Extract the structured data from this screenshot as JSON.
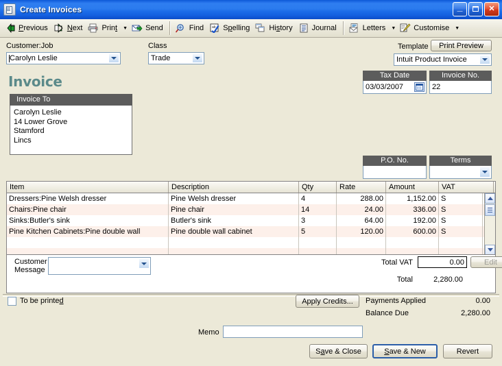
{
  "window": {
    "title": "Create Invoices",
    "icon": "invoice-window-icon",
    "minimize_label": "_",
    "maximize_label": "",
    "close_label": "✕"
  },
  "toolbar": {
    "items": [
      {
        "label": "Previous",
        "icon": "previous-arrow-icon",
        "dropdown": false
      },
      {
        "label": "Next",
        "icon": "next-arrow-icon",
        "dropdown": false
      },
      {
        "label": "Print",
        "icon": "printer-icon",
        "dropdown": true
      },
      {
        "label": "Send",
        "icon": "send-envelope-icon",
        "dropdown": false
      },
      {
        "label": "Find",
        "icon": "find-magnifier-icon",
        "dropdown": false
      },
      {
        "label": "Spelling",
        "icon": "spelling-check-icon",
        "dropdown": false
      },
      {
        "label": "History",
        "icon": "history-windows-icon",
        "dropdown": false
      },
      {
        "label": "Journal",
        "icon": "journal-lines-icon",
        "dropdown": false
      },
      {
        "label": "Letters",
        "icon": "letters-envelope-icon",
        "dropdown": true
      },
      {
        "label": "Customise",
        "icon": "customise-pencil-icon",
        "dropdown": true
      }
    ]
  },
  "form": {
    "customer_job_label": "Customer:Job",
    "customer_job_value": "Carolyn Leslie",
    "class_label": "Class",
    "class_value": "Trade",
    "template_label": "Template",
    "print_preview_label": "Print Preview",
    "template_value": "Intuit Product Invoice"
  },
  "invoice": {
    "heading": "Invoice",
    "invoice_to_label": "Invoice To",
    "invoice_to_lines": [
      "Carolyn Leslie",
      "14 Lower Grove",
      "Stamford",
      "Lincs"
    ],
    "tax_date_label": "Tax Date",
    "tax_date_value": "03/03/2007",
    "calendar_icon": "calendar-icon",
    "invoice_no_label": "Invoice No.",
    "invoice_no_value": "22",
    "po_no_label": "P.O. No.",
    "po_no_value": "",
    "terms_label": "Terms",
    "terms_value": ""
  },
  "line_items": {
    "columns": [
      "Item",
      "Description",
      "Qty",
      "Rate",
      "Amount",
      "VAT"
    ],
    "rows": [
      {
        "item": "Dressers:Pine Welsh dresser",
        "description": "Pine Welsh dresser",
        "qty": "4",
        "rate": "288.00",
        "amount": "1,152.00",
        "vat": "S"
      },
      {
        "item": "Chairs:Pine chair",
        "description": "Pine chair",
        "qty": "14",
        "rate": "24.00",
        "amount": "336.00",
        "vat": "S"
      },
      {
        "item": "Sinks:Butler's sink",
        "description": "Butler's sink",
        "qty": "3",
        "rate": "64.00",
        "amount": "192.00",
        "vat": "S"
      },
      {
        "item": "Pine Kitchen Cabinets:Pine double wall",
        "description": "Pine double wall cabinet",
        "qty": "5",
        "rate": "120.00",
        "amount": "600.00",
        "vat": "S"
      }
    ]
  },
  "footer": {
    "customer_message_label_1": "Customer",
    "customer_message_label_2": "Message",
    "customer_message_value": "",
    "total_vat_label": "Total VAT",
    "total_vat_value": "0.00",
    "edit_label": "Edit",
    "total_label": "Total",
    "total_value": "2,280.00",
    "to_be_printed_label": "To be printed",
    "to_be_printed_checked": false,
    "apply_credits_label": "Apply Credits...",
    "payments_applied_label": "Payments Applied",
    "payments_applied_value": "0.00",
    "balance_due_label": "Balance Due",
    "balance_due_value": "2,280.00",
    "memo_label": "Memo",
    "memo_value": "",
    "save_close_label": "Save & Close",
    "save_new_label": "Save & New",
    "revert_label": "Revert"
  },
  "colors": {
    "title_blue": "#2b7bee",
    "heading_teal": "#5b8a8a",
    "dark_header": "#5c5c5c",
    "panel_bg": "#ece9d8",
    "row_alt": "#fdf0ea"
  }
}
